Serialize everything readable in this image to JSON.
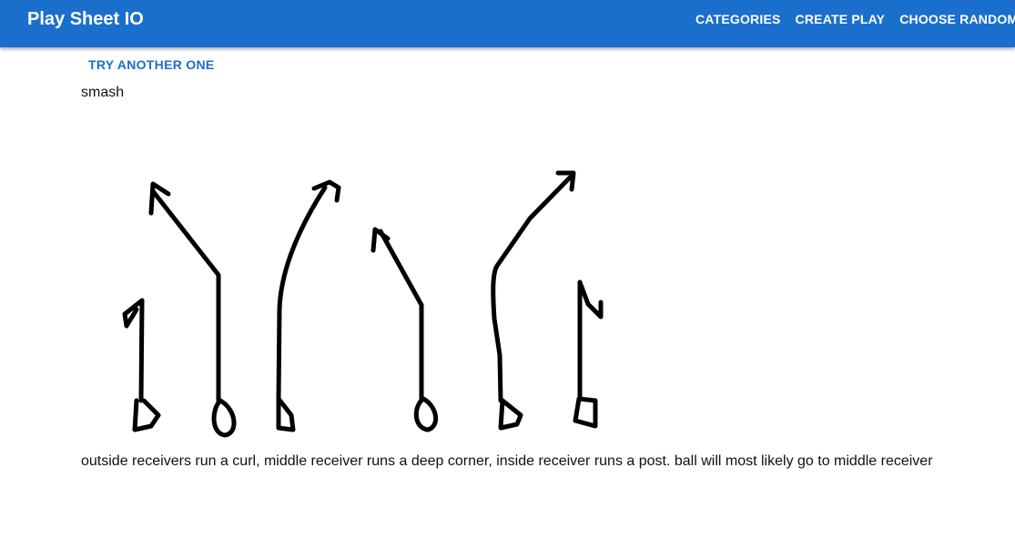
{
  "app_bar": {
    "title": "Play Sheet IO",
    "nav": [
      "CATEGORIES",
      "CREATE PLAY",
      "CHOOSE RANDOM PLAY"
    ],
    "color": "#1b6fcc"
  },
  "main": {
    "try_button_label": "TRY ANOTHER ONE",
    "play_name": "smash",
    "description": "outside receivers run a curl, middle receiver runs a deep corner, inside receiver runs a post. ball will most likely go to middle receiver"
  }
}
